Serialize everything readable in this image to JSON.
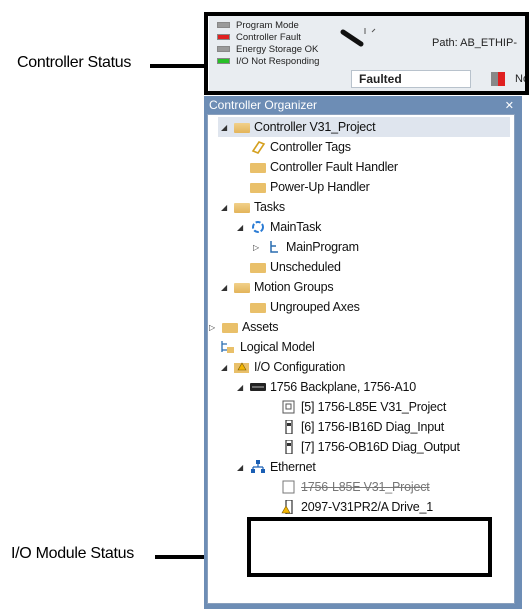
{
  "callouts": {
    "controller_status": "Controller Status",
    "io_module_status": "I/O Module Status"
  },
  "status": {
    "indicators": [
      {
        "label": "Program Mode",
        "color": "#9a9a9a"
      },
      {
        "label": "Controller Fault",
        "color": "#e02020"
      },
      {
        "label": "Energy Storage OK",
        "color": "#9a9a9a"
      },
      {
        "label": "I/O Not Responding",
        "color": "#28c028"
      }
    ],
    "path": "Path: AB_ETHIP-",
    "mode_value": "Faulted",
    "fault_text": "No F"
  },
  "organizer": {
    "title": "Controller Organizer",
    "close": "✕",
    "items": [
      {
        "label": "Controller V31_Project",
        "icon": "folder-open-icon"
      },
      {
        "label": "Controller Tags",
        "icon": "tag-icon"
      },
      {
        "label": "Controller Fault Handler",
        "icon": "folder-icon"
      },
      {
        "label": "Power-Up Handler",
        "icon": "folder-icon"
      },
      {
        "label": "Tasks",
        "icon": "folder-open-icon"
      },
      {
        "label": "MainTask",
        "icon": "task-cycle-icon"
      },
      {
        "label": "MainProgram",
        "icon": "program-icon"
      },
      {
        "label": "Unscheduled",
        "icon": "folder-icon"
      },
      {
        "label": "Motion Groups",
        "icon": "folder-open-icon"
      },
      {
        "label": "Ungrouped Axes",
        "icon": "folder-icon"
      },
      {
        "label": "Assets",
        "icon": "folder-icon"
      },
      {
        "label": "Logical Model",
        "icon": "logical-model-icon"
      },
      {
        "label": "I/O Configuration",
        "icon": "folder-warning-icon"
      },
      {
        "label": "1756 Backplane, 1756-A10",
        "icon": "backplane-icon"
      },
      {
        "label": "[5] 1756-L85E V31_Project",
        "icon": "controller-module-icon"
      },
      {
        "label": "[6] 1756-IB16D Diag_Input",
        "icon": "io-module-icon"
      },
      {
        "label": "[7] 1756-OB16D Diag_Output",
        "icon": "io-module-icon"
      },
      {
        "label": "Ethernet",
        "icon": "network-icon"
      },
      {
        "label": "1756-L85E V31_Project",
        "icon": "controller-module-icon"
      },
      {
        "label": "2097-V31PR2/A Drive_1",
        "icon": "drive-warning-icon"
      }
    ]
  }
}
